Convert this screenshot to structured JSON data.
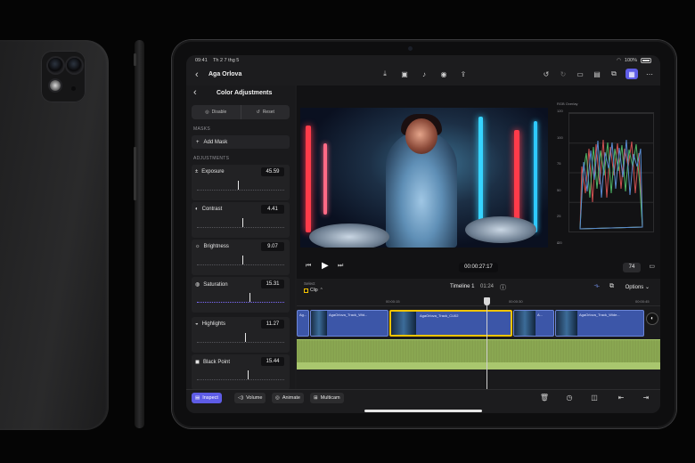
{
  "status": {
    "time": "09:41",
    "date": "Th 2 7 thg 5",
    "battery": "100%"
  },
  "header": {
    "title": "Aga Orlova"
  },
  "inspector": {
    "title": "Color Adjustments",
    "disable_label": "Disable",
    "reset_label": "Reset",
    "masks_label": "MASKS",
    "add_mask_label": "Add Mask",
    "adjustments_label": "ADJUSTMENTS",
    "adjustments": [
      {
        "label": "Exposure",
        "value": "45.59",
        "level": 0.47
      },
      {
        "label": "Contrast",
        "value": "4.41",
        "level": 0.52
      },
      {
        "label": "Brightness",
        "value": "9.07",
        "level": 0.52
      },
      {
        "label": "Saturation",
        "value": "15.31",
        "level": 0.6
      },
      {
        "label": "Highlights",
        "value": "11.27",
        "level": 0.55
      },
      {
        "label": "Black Point",
        "value": "15.44",
        "level": 0.58
      }
    ]
  },
  "scope": {
    "label": "RGB Overlay",
    "axis": [
      "120",
      "100",
      "75",
      "50",
      "25",
      "0",
      "-20"
    ]
  },
  "viewer": {
    "timecode": "00:00:27:17",
    "zoom": "74"
  },
  "timeline": {
    "select_label": "Select",
    "clip_label": "Clip",
    "name": "Timeline 1",
    "duration": "01:24",
    "options_label": "Options",
    "ruler": [
      "00:00:15",
      "00:00:30",
      "00:00:45"
    ],
    "clips": [
      "Ag...",
      "AgaOrlova_Track_Wid...",
      "AgaOrlova_Track_CU02",
      "A...",
      "AgaOrlova_Track_Wide..."
    ]
  },
  "bottombar": {
    "inspect": "Inspect",
    "volume": "Volume",
    "animate": "Animate",
    "multicam": "Multicam"
  },
  "colors": {
    "accent": "#5e5ce6",
    "clip_blue": "#3c56a8",
    "audio_green": "#8fae56",
    "selection": "#f5c400"
  }
}
